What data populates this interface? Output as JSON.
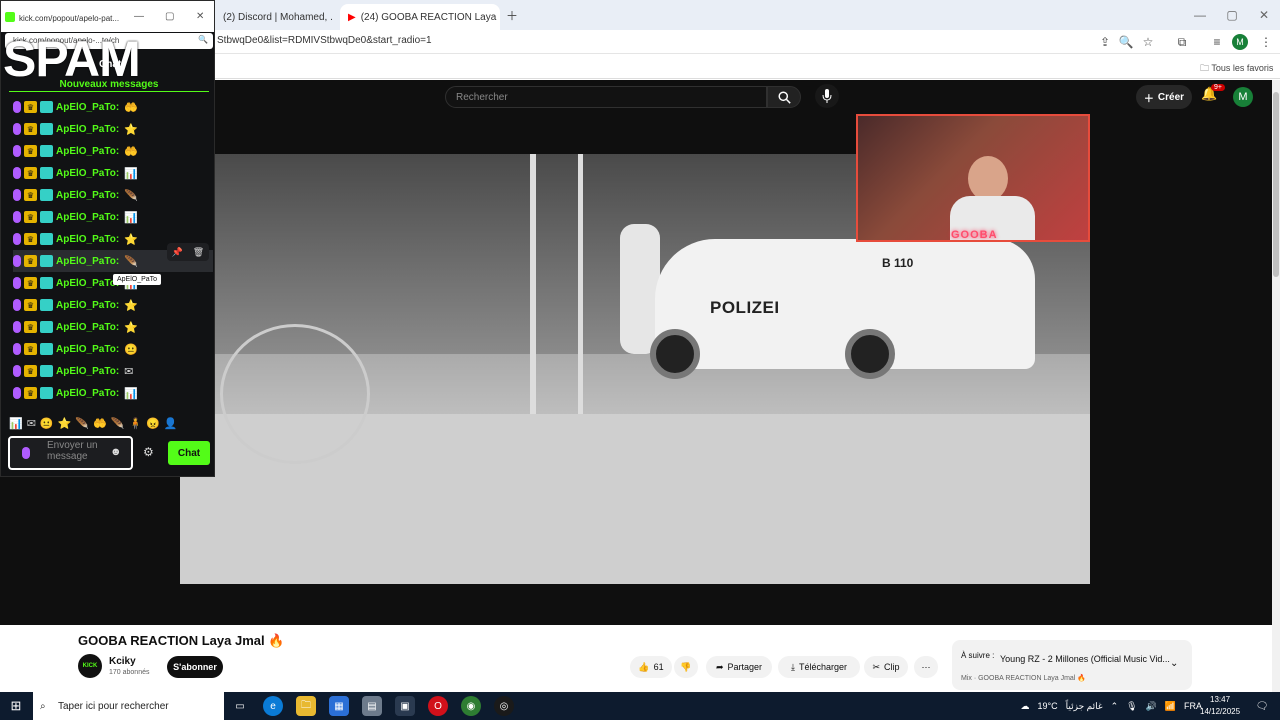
{
  "browser": {
    "tabs": [
      {
        "label": "(2) Discord | Mohamed, ...",
        "icon": "discord-icon"
      },
      {
        "label": "(24) GOOBA REACTION Laya ...",
        "icon": "youtube-icon"
      }
    ],
    "url": "StbwqDe0&list=RDMIVStbwqDe0&start_radio=1",
    "bookmarks_label": "Tous les favoris",
    "profile_initial": "M"
  },
  "youtube": {
    "search_placeholder": "Rechercher",
    "create_label": "Créer",
    "notif_count": "9+",
    "avatar_initial": "M",
    "police_text": "POLIZEI",
    "car_plate": "B 110",
    "webcam_label": "GOOBA",
    "video_title": "GOOBA REACTION Laya Jmal 🔥",
    "channel": {
      "avatar_text": "KICK",
      "name": "Kciky",
      "subs": "170 abonnés"
    },
    "subscribe_label": "S'abonner",
    "likes": "61",
    "share_label": "Partager",
    "download_label": "Télécharger",
    "clip_label": "Clip",
    "up_next": {
      "prefix": "À suivre :",
      "title": "Young RZ - 2 Millones (Official Music Vid...",
      "mix": "Mix · GOOBA REACTION Laya Jmal 🔥"
    }
  },
  "popup": {
    "title": "kick.com/popout/apelo-pat...",
    "url": "kick.com/popout/apelo-...to/ch",
    "overlay_text": "SPAM",
    "chat_label": "Chat",
    "new_messages": "Nouveaux messages",
    "username": "ApElO_PaTo:",
    "tooltip": "ApElO_PaTo",
    "emotes": [
      "🤲",
      "⭐",
      "🤲",
      "📊",
      "🪶",
      "📊",
      "⭐",
      "🪶",
      "📊",
      "⭐",
      "⭐",
      "😐",
      "✉",
      "📊"
    ],
    "input_placeholder": "Envoyer un message",
    "send_label": "Chat"
  },
  "taskbar": {
    "search_placeholder": "Taper ici pour rechercher",
    "weather": "19°C",
    "weather_text": "غائم جزئياً",
    "lang": "FRA",
    "time": "13:47",
    "date": "14/12/2025"
  }
}
